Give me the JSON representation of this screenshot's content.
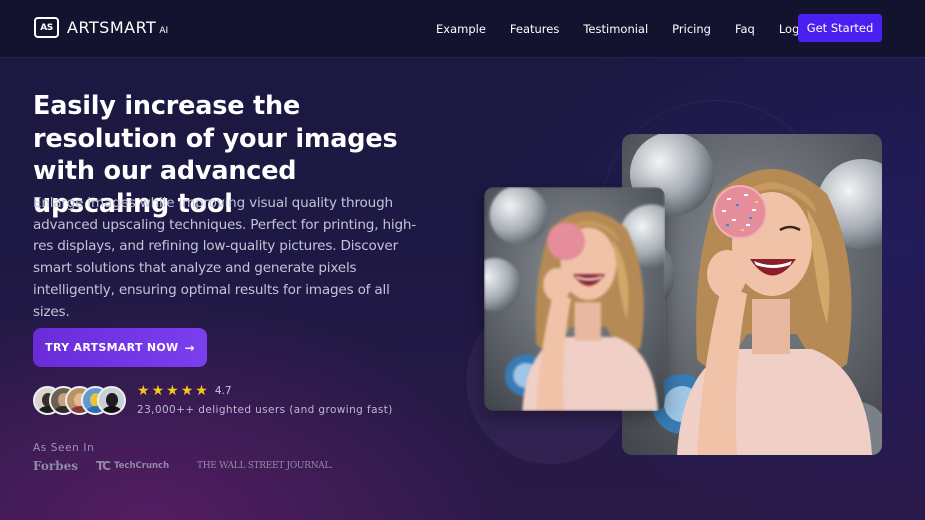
{
  "nav": {
    "logo_mark": "AS",
    "logo_text": "ARTSMART",
    "logo_suffix": "AI",
    "links": [
      "Example",
      "Features",
      "Testimonial",
      "Pricing",
      "Faq",
      "Login"
    ],
    "cta": "Get Started"
  },
  "hero": {
    "title": "Easily increase the resolution of your images with our advanced upscaling tool",
    "description": "Enlarge images while improving visual quality through advanced upscaling techniques. Perfect for printing, high-res displays, and refining low-quality pictures. Discover smart solutions that analyze and generate pixels intelligently, ensuring optimal results for images of all sizes.",
    "cta": "TRY ARTSMART NOW",
    "cta_arrow": "→"
  },
  "social_proof": {
    "stars": 5,
    "rating": "4.7",
    "users": "23,000++ delighted users (and growing fast)"
  },
  "press": {
    "label": "As Seen In",
    "logos": [
      "Forbes",
      "TechCrunch",
      "THE WALL STREET JOURNAL."
    ],
    "techcrunch_mark": "TC"
  },
  "colors": {
    "accent": "#4b1ff0",
    "cta_gradient_start": "#6a2bd8",
    "cta_gradient_end": "#7b3ff0",
    "star": "#f7c61a"
  }
}
